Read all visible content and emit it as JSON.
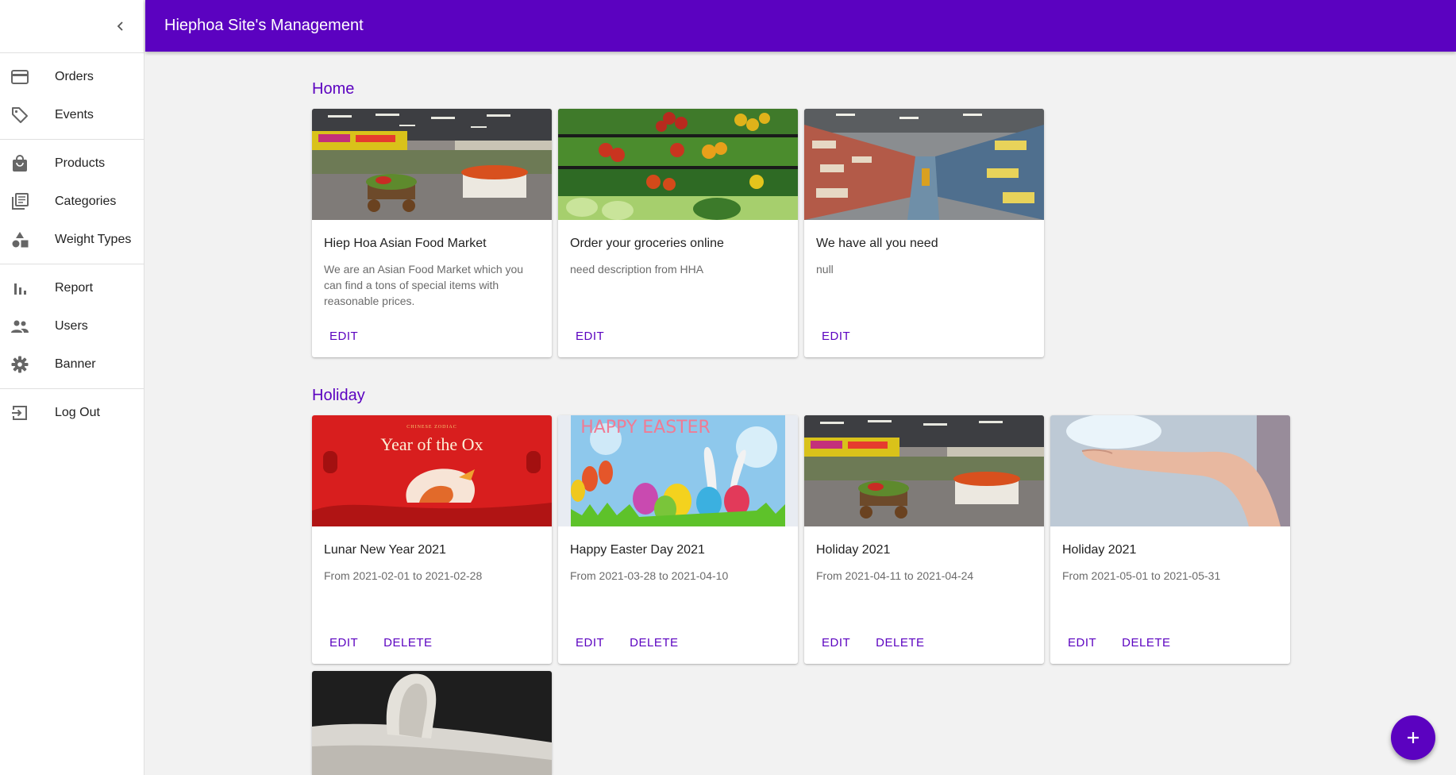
{
  "app": {
    "title": "Hiephoa Site's Management"
  },
  "drawer": {
    "collapse_icon": "chevron-left-icon",
    "groups": [
      [
        {
          "label": "Orders",
          "icon": "credit-card-icon"
        },
        {
          "label": "Events",
          "icon": "tag-icon"
        }
      ],
      [
        {
          "label": "Products",
          "icon": "shopping-bag-icon"
        },
        {
          "label": "Categories",
          "icon": "library-books-icon"
        },
        {
          "label": "Weight Types",
          "icon": "shapes-icon"
        }
      ],
      [
        {
          "label": "Report",
          "icon": "bar-chart-icon"
        },
        {
          "label": "Users",
          "icon": "people-icon"
        },
        {
          "label": "Banner",
          "icon": "gear-icon"
        }
      ],
      [
        {
          "label": "Log Out",
          "icon": "logout-icon"
        }
      ]
    ]
  },
  "sections": {
    "home": {
      "title": "Home",
      "cards": [
        {
          "title": "Hiep Hoa Asian Food Market",
          "description": "We are an Asian Food Market which you can find a tons of special items with reasonable prices.",
          "edit": "EDIT",
          "image": "supermarket-produce-photo"
        },
        {
          "title": "Order your groceries online",
          "description": "need description from HHA",
          "edit": "EDIT",
          "image": "vegetable-shelves-photo"
        },
        {
          "title": "We have all you need",
          "description": "null",
          "edit": "EDIT",
          "image": "grocery-aisle-photo"
        }
      ]
    },
    "holiday": {
      "title": "Holiday",
      "cards": [
        {
          "title": "Lunar New Year 2021",
          "description": "From 2021-02-01 to 2021-02-28",
          "edit": "EDIT",
          "delete": "DELETE",
          "image": "year-of-the-ox-banner",
          "image_text_small": "CHINESE ZODIAC",
          "image_text": "Year of the Ox"
        },
        {
          "title": "Happy Easter Day 2021",
          "description": "From 2021-03-28 to 2021-04-10",
          "edit": "EDIT",
          "delete": "DELETE",
          "image": "easter-eggs-banner",
          "image_text": "HAPPY EASTER"
        },
        {
          "title": "Holiday 2021",
          "description": "From 2021-04-11 to 2021-04-24",
          "edit": "EDIT",
          "delete": "DELETE",
          "image": "supermarket-produce-photo"
        },
        {
          "title": "Holiday 2021",
          "description": "From 2021-05-01 to 2021-05-31",
          "edit": "EDIT",
          "delete": "DELETE",
          "image": "hand-photo"
        },
        {
          "image": "fabric-roll-photo"
        }
      ]
    }
  },
  "fab": {
    "icon": "plus-icon"
  },
  "colors": {
    "primary": "#5b02c0",
    "background": "#f2f2f2"
  }
}
